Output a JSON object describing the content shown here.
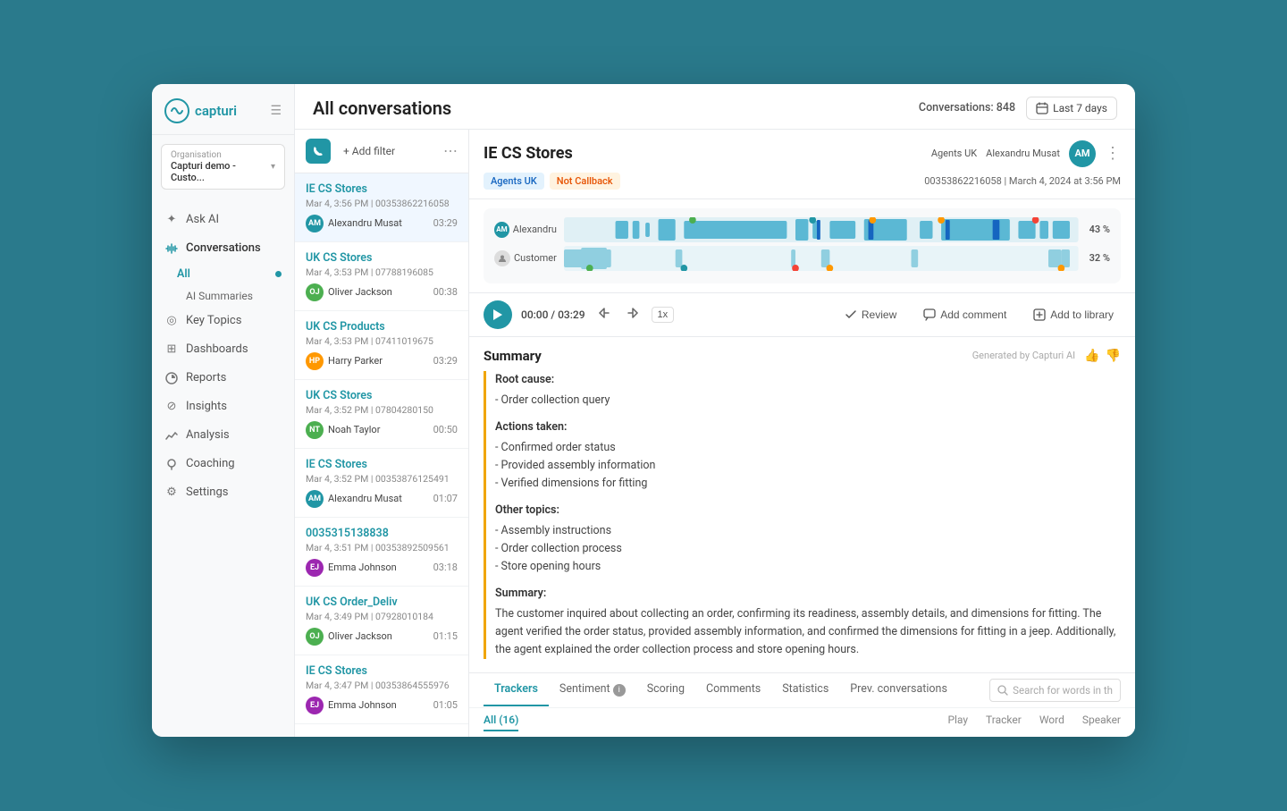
{
  "app": {
    "logo_text": "capturi",
    "bg_color": "#2a7a8c"
  },
  "sidebar": {
    "org_label": "Organisation",
    "org_name": "Capturi demo - Custo...",
    "nav_items": [
      {
        "id": "ask-ai",
        "label": "Ask AI",
        "icon": "sparkle"
      },
      {
        "id": "conversations",
        "label": "Conversations",
        "icon": "waveform",
        "active": true
      },
      {
        "id": "key-topics",
        "label": "Key Topics",
        "icon": "circle"
      },
      {
        "id": "dashboards",
        "label": "Dashboards",
        "icon": "grid"
      },
      {
        "id": "reports",
        "label": "Reports",
        "icon": "chart"
      },
      {
        "id": "insights",
        "label": "Insights",
        "icon": "lightbulb"
      },
      {
        "id": "analysis",
        "label": "Analysis",
        "icon": "trend"
      },
      {
        "id": "coaching",
        "label": "Coaching",
        "icon": "pin"
      },
      {
        "id": "settings",
        "label": "Settings",
        "icon": "gear"
      }
    ],
    "sub_items": [
      {
        "id": "all",
        "label": "All",
        "active": true
      },
      {
        "id": "ai-summaries",
        "label": "AI Summaries"
      }
    ]
  },
  "header": {
    "title": "All conversations",
    "conversations_count_label": "Conversations:",
    "conversations_count": "848",
    "date_filter": "Last 7 days",
    "add_filter_label": "+ Add filter"
  },
  "conversation_list": {
    "items": [
      {
        "id": "conv-1",
        "title": "IE CS Stores",
        "date": "Mar 4, 3:56 PM",
        "phone": "00353862216058",
        "agent_name": "Alexandru Musat",
        "avatar_initials": "AM",
        "avatar_color": "#2196a5",
        "duration": "03:29",
        "selected": true
      },
      {
        "id": "conv-2",
        "title": "UK CS Stores",
        "date": "Mar 4, 3:53 PM",
        "phone": "07788196085",
        "agent_name": "Oliver Jackson",
        "avatar_initials": "OJ",
        "avatar_color": "#4caf50",
        "duration": "00:38",
        "selected": false
      },
      {
        "id": "conv-3",
        "title": "UK CS Products",
        "date": "Mar 4, 3:53 PM",
        "phone": "07411019675",
        "agent_name": "Harry Parker",
        "avatar_initials": "HP",
        "avatar_color": "#ff9800",
        "duration": "03:29",
        "selected": false
      },
      {
        "id": "conv-4",
        "title": "UK CS Stores",
        "date": "Mar 4, 3:52 PM",
        "phone": "07804280150",
        "agent_name": "Noah Taylor",
        "avatar_initials": "NT",
        "avatar_color": "#4caf50",
        "duration": "00:50",
        "selected": false
      },
      {
        "id": "conv-5",
        "title": "IE CS Stores",
        "date": "Mar 4, 3:52 PM",
        "phone": "00353876125491",
        "agent_name": "Alexandru Musat",
        "avatar_initials": "AM",
        "avatar_color": "#2196a5",
        "duration": "01:07",
        "selected": false
      },
      {
        "id": "conv-6",
        "title": "0035315138838",
        "date": "Mar 4, 3:51 PM",
        "phone": "00353892509561",
        "agent_name": "Emma Johnson",
        "avatar_initials": "EJ",
        "avatar_color": "#9c27b0",
        "duration": "03:18",
        "selected": false
      },
      {
        "id": "conv-7",
        "title": "UK CS Order_Deliv",
        "date": "Mar 4, 3:49 PM",
        "phone": "07928010184",
        "agent_name": "Oliver Jackson",
        "avatar_initials": "OJ",
        "avatar_color": "#4caf50",
        "duration": "01:15",
        "selected": false
      },
      {
        "id": "conv-8",
        "title": "IE CS Stores",
        "date": "Mar 4, 3:47 PM",
        "phone": "00353864555976",
        "agent_name": "Emma Johnson",
        "avatar_initials": "EJ",
        "avatar_color": "#9c27b0",
        "duration": "01:05",
        "selected": false
      }
    ]
  },
  "detail": {
    "title": "IE CS Stores",
    "tag1": "Agents UK",
    "tag2": "Not Callback",
    "agent_group": "Agents UK",
    "agent_name": "Alexandru Musat",
    "phone_date": "00353862216058 | March 4, 2024 at 3:56 PM",
    "avatar_initials": "AM",
    "avatar_color": "#2196a5",
    "speaker1_label": "Alexandru",
    "speaker1_pct": "43 %",
    "speaker2_label": "Customer",
    "speaker2_pct": "32 %",
    "player_time": "00:00 / 03:29",
    "play_label": "Play",
    "speed": "1x",
    "review_label": "Review",
    "add_comment_label": "Add comment",
    "add_to_library_label": "Add to library",
    "summary_title": "Summary",
    "generated_by": "Generated by Capturi AI",
    "summary_content": {
      "root_cause_title": "Root cause:",
      "root_cause": "- Order collection query",
      "actions_title": "Actions taken:",
      "actions": [
        "- Confirmed order status",
        "- Provided assembly information",
        "- Verified dimensions for fitting"
      ],
      "other_topics_title": "Other topics:",
      "other_topics": [
        "- Assembly instructions",
        "- Order collection process",
        "- Store opening hours"
      ],
      "summary_title": "Summary:",
      "summary_text": "The customer inquired about collecting an order, confirming its readiness, assembly details, and dimensions for fitting. The agent verified the order status, provided assembly information, and confirmed the dimensions for fitting in a jeep. Additionally, the agent explained the order collection process and store opening hours."
    },
    "bottom_tabs": [
      {
        "id": "trackers",
        "label": "Trackers",
        "active": true
      },
      {
        "id": "sentiment",
        "label": "Sentiment",
        "has_info": true
      },
      {
        "id": "scoring",
        "label": "Scoring"
      },
      {
        "id": "comments",
        "label": "Comments"
      },
      {
        "id": "statistics",
        "label": "Statistics"
      },
      {
        "id": "prev-conversations",
        "label": "Prev. conversations"
      }
    ],
    "search_placeholder": "Search for words in th",
    "trackers_all_label": "All (16)",
    "trackers_play_col": "Play",
    "trackers_tracker_col": "Tracker",
    "trackers_word_col": "Word",
    "trackers_speaker_col": "Speaker"
  }
}
